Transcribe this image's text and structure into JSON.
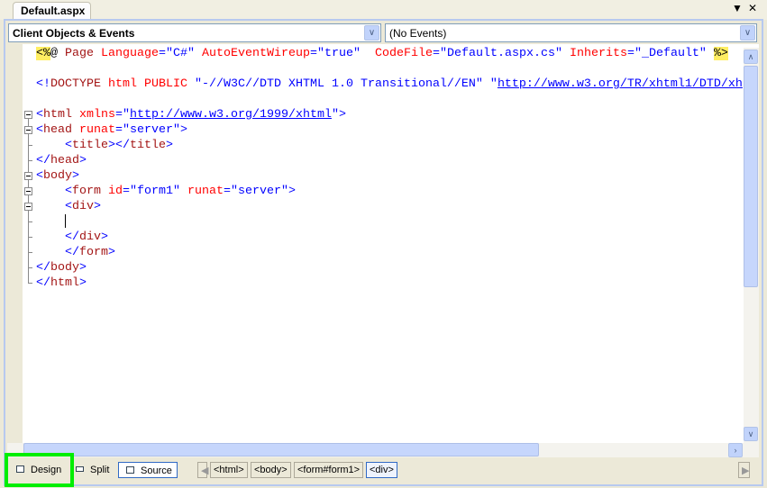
{
  "tab": {
    "title": "Default.aspx"
  },
  "window_buttons": {
    "menu": "▼",
    "close": "✕"
  },
  "combos": {
    "objects": "Client Objects & Events",
    "events": "(No Events)"
  },
  "code_lines": [
    [
      [
        "d",
        "<%"
      ],
      [
        "d2",
        "@"
      ],
      [
        "p",
        " "
      ],
      [
        "n",
        "Page"
      ],
      [
        "p",
        " "
      ],
      [
        "a",
        "Language"
      ],
      [
        "v",
        "=\"C#\""
      ],
      [
        "p",
        " "
      ],
      [
        "a",
        "AutoEventWireup"
      ],
      [
        "v",
        "=\"true\""
      ],
      [
        "p",
        "  "
      ],
      [
        "a",
        "CodeFile"
      ],
      [
        "v",
        "=\"Default.aspx.cs\""
      ],
      [
        "p",
        " "
      ],
      [
        "a",
        "Inherits"
      ],
      [
        "v",
        "=\"_Default\""
      ],
      [
        "p",
        " "
      ],
      [
        "d",
        "%>"
      ]
    ],
    [],
    [
      [
        "p",
        "<!"
      ],
      [
        "n",
        "DOCTYPE"
      ],
      [
        "p",
        " "
      ],
      [
        "a",
        "html"
      ],
      [
        "p",
        " "
      ],
      [
        "a",
        "PUBLIC"
      ],
      [
        "v",
        " \"-//W3C//DTD XHTML 1.0 Transitional//EN\" \""
      ],
      [
        "u",
        "http://www.w3.org/TR/xhtml1/DTD/xh"
      ]
    ],
    [],
    [
      [
        "p",
        "<"
      ],
      [
        "n",
        "html"
      ],
      [
        "p",
        " "
      ],
      [
        "a",
        "xmlns"
      ],
      [
        "v",
        "=\""
      ],
      [
        "u",
        "http://www.w3.org/1999/xhtml"
      ],
      [
        "v",
        "\""
      ],
      [
        "p",
        ">"
      ]
    ],
    [
      [
        "p",
        "<"
      ],
      [
        "n",
        "head"
      ],
      [
        "p",
        " "
      ],
      [
        "a",
        "runat"
      ],
      [
        "v",
        "=\"server\""
      ],
      [
        "p",
        ">"
      ]
    ],
    [
      [
        "p",
        "    <"
      ],
      [
        "n",
        "title"
      ],
      [
        "p",
        "></"
      ],
      [
        "n",
        "title"
      ],
      [
        "p",
        ">"
      ]
    ],
    [
      [
        "p",
        "</"
      ],
      [
        "n",
        "head"
      ],
      [
        "p",
        ">"
      ]
    ],
    [
      [
        "p",
        "<"
      ],
      [
        "n",
        "body"
      ],
      [
        "p",
        ">"
      ]
    ],
    [
      [
        "p",
        "    <"
      ],
      [
        "n",
        "form"
      ],
      [
        "p",
        " "
      ],
      [
        "a",
        "id"
      ],
      [
        "v",
        "=\"form1\""
      ],
      [
        "p",
        " "
      ],
      [
        "a",
        "runat"
      ],
      [
        "v",
        "=\"server\""
      ],
      [
        "p",
        ">"
      ]
    ],
    [
      [
        "p",
        "    <"
      ],
      [
        "n",
        "div"
      ],
      [
        "p",
        ">"
      ]
    ],
    [
      [
        "p",
        "    "
      ],
      [
        "c",
        "|"
      ]
    ],
    [
      [
        "p",
        "    </"
      ],
      [
        "n",
        "div"
      ],
      [
        "p",
        ">"
      ]
    ],
    [
      [
        "p",
        "    </"
      ],
      [
        "n",
        "form"
      ],
      [
        "p",
        ">"
      ]
    ],
    [
      [
        "p",
        "</"
      ],
      [
        "n",
        "body"
      ],
      [
        "p",
        ">"
      ]
    ],
    [
      [
        "p",
        "</"
      ],
      [
        "n",
        "html"
      ],
      [
        "p",
        ">"
      ]
    ]
  ],
  "view_buttons": {
    "design": "Design",
    "split": "Split",
    "source": "Source",
    "active": "Source"
  },
  "breadcrumbs": [
    "<html>",
    "<body>",
    "<form#form1>",
    "<div>"
  ],
  "colors": {
    "element": "#a31515",
    "attribute": "#ff0000",
    "value": "#0000ff",
    "directive_bg": "#ffee62",
    "highlight": "#00ee00"
  }
}
